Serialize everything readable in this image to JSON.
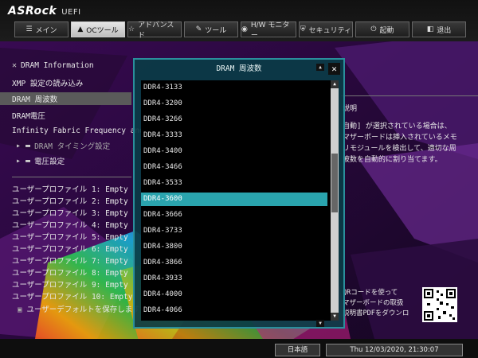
{
  "brand": {
    "logo": "ASRock",
    "subtitle": "UEFI"
  },
  "tabs": [
    {
      "label": "メイン",
      "icon": "list-icon"
    },
    {
      "label": "OCツール",
      "icon": "rocket-icon",
      "active": true
    },
    {
      "label": "アドバンスド",
      "icon": "star-icon"
    },
    {
      "label": "ツール",
      "icon": "wrench-icon"
    },
    {
      "label": "H/W モニター",
      "icon": "monitor-icon"
    },
    {
      "label": "セキュリティ",
      "icon": "shield-icon"
    },
    {
      "label": "起動",
      "icon": "power-icon"
    },
    {
      "label": "退出",
      "icon": "exit-icon"
    }
  ],
  "menu": {
    "dram_info": "DRAM Information",
    "xmp": "XMP 設定の読み込み",
    "dram_freq": "DRAM 周波数",
    "dram_voltage": "DRAM電圧",
    "infinity_fabric": "Infinity Fabric Frequency and Di",
    "dram_timing": "DRAM タイミング設定",
    "voltage": "電圧設定"
  },
  "profiles": [
    "ユーザープロファイル 1: Empty",
    "ユーザープロファイル 2: Empty",
    "ユーザープロファイル 3: Empty",
    "ユーザープロファイル 4: Empty",
    "ユーザープロファイル 5: Empty",
    "ユーザープロファイル 6: Empty",
    "ユーザープロファイル 7: Empty",
    "ユーザープロファイル 8: Empty",
    "ユーザープロファイル 9: Empty",
    "ユーザープロファイル 10: Empty"
  ],
  "save_default": "ユーザーデフォルトを保存します",
  "help": {
    "title": "説明",
    "line1": "自動] が選択されている場合は、",
    "line2": "マザーボードは挿入されているメモ",
    "line3": "リモジュールを検出して、適切な周",
    "line4": "波数を自動的に割り当てます。"
  },
  "qr": {
    "line1": "QRコードを使って",
    "line2": "マザーボードの取扱",
    "line3": "説明書PDFをダウンロ"
  },
  "popup": {
    "title": "DRAM 周波数",
    "close": "✕",
    "options": [
      "DDR4-3133",
      "DDR4-3200",
      "DDR4-3266",
      "DDR4-3333",
      "DDR4-3400",
      "DDR4-3466",
      "DDR4-3533",
      "DDR4-3600",
      "DDR4-3666",
      "DDR4-3733",
      "DDR4-3800",
      "DDR4-3866",
      "DDR4-3933",
      "DDR4-4000",
      "DDR4-4066"
    ],
    "selected": "DDR4-3600"
  },
  "footer": {
    "language": "日本語",
    "datetime": "Thu 12/03/2020, 21:30:07"
  }
}
